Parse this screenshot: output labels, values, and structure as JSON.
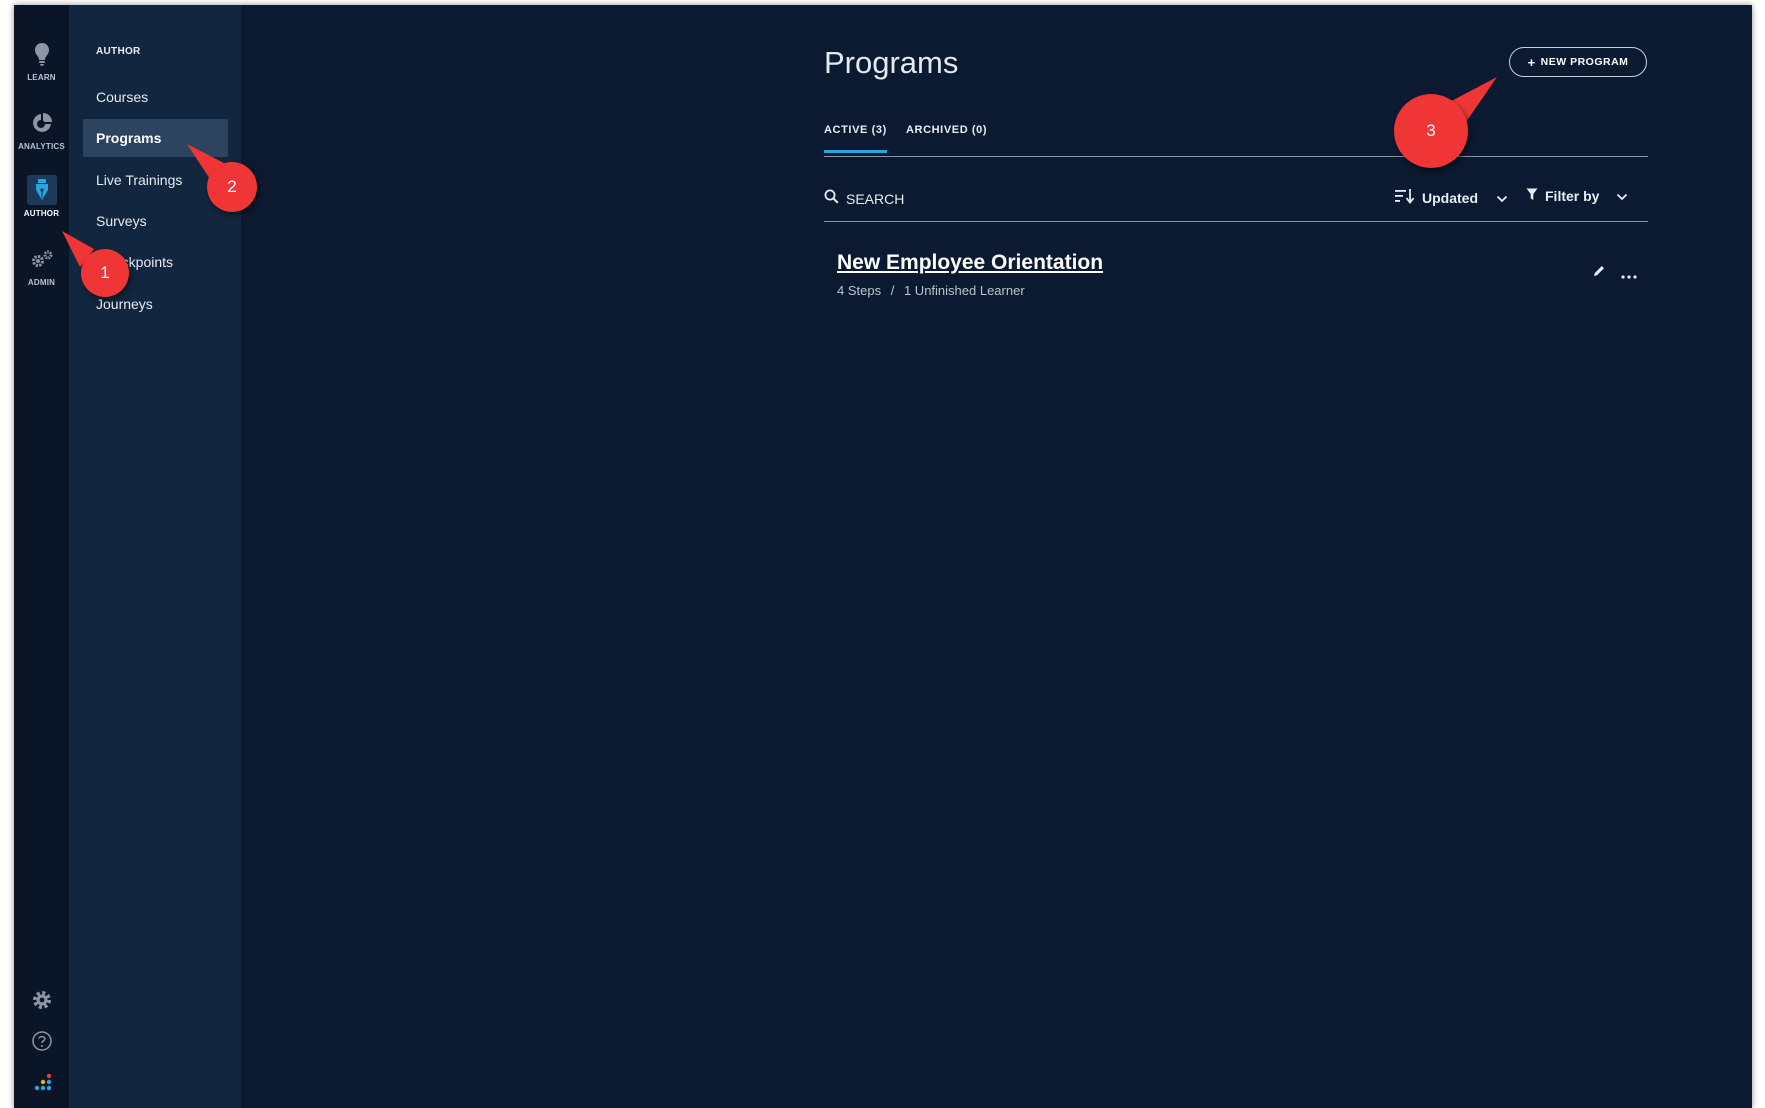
{
  "rail": {
    "items": [
      {
        "label": "LEARN",
        "icon": "lightbulb-icon"
      },
      {
        "label": "ANALYTICS",
        "icon": "analytics-icon"
      },
      {
        "label": "AUTHOR",
        "icon": "pen-icon",
        "active": true
      },
      {
        "label": "ADMIN",
        "icon": "gears-icon"
      }
    ],
    "bottom_icons": [
      "gear-icon",
      "help-icon",
      "logo-icon"
    ]
  },
  "subnav": {
    "title": "AUTHOR",
    "items": [
      {
        "label": "Courses"
      },
      {
        "label": "Programs",
        "active": true
      },
      {
        "label": "Live Trainings"
      },
      {
        "label": "Surveys"
      },
      {
        "label": "Checkpoints"
      },
      {
        "label": "Journeys"
      }
    ]
  },
  "page": {
    "title": "Programs",
    "new_button": {
      "icon_text": "+",
      "label": "NEW PROGRAM"
    }
  },
  "tabs": [
    {
      "label": "ACTIVE (3)",
      "active": true
    },
    {
      "label": "ARCHIVED (0)"
    }
  ],
  "toolbar": {
    "search_placeholder": "SEARCH",
    "sort_label": "Updated",
    "filter_label": "Filter by"
  },
  "programs": [
    {
      "title": "New Employee Orientation",
      "steps": "4 Steps",
      "separator": "/",
      "learners": "1 Unfinished Learner"
    }
  ],
  "callouts": [
    "1",
    "2",
    "3"
  ],
  "colors": {
    "background": "#0b1a30",
    "rail": "#0a1628",
    "subnav": "#13263f",
    "active_nav": "#2c4460",
    "tab_accent": "#2aa3de",
    "callout": "#ef3535"
  }
}
